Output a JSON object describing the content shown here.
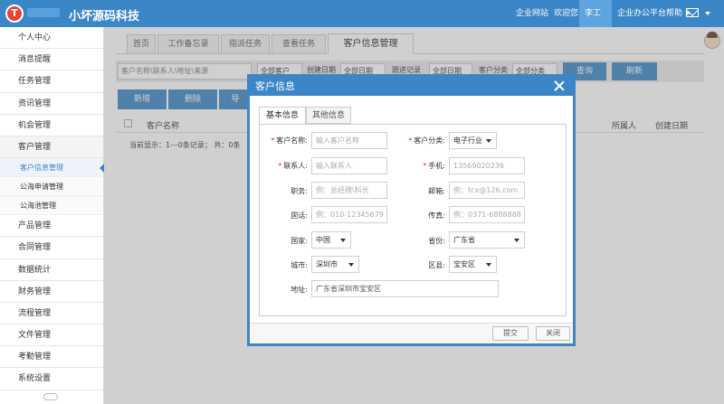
{
  "app": {
    "logo_letter": "T",
    "brand": "小坏源码科技"
  },
  "topnav": {
    "website": "企业网站",
    "welcome": "欢迎您",
    "user": "李工",
    "help": "企业办公平台帮助"
  },
  "sidebar": {
    "items": [
      "个人中心",
      "消息提醒",
      "任务管理",
      "资讯管理",
      "机会管理",
      "客户管理"
    ],
    "subitems": [
      "客户信息管理",
      "公海申请管理",
      "公海池管理"
    ],
    "items_after": [
      "产品管理",
      "合同管理",
      "数据统计",
      "财务管理",
      "流程管理",
      "文件管理",
      "考勤管理",
      "系统设置"
    ]
  },
  "tabs": [
    "首页",
    "工作备忘录",
    "指派任务",
    "查看任务",
    "客户信息管理"
  ],
  "search": {
    "keyword_placeholder": "客户名称\\联系人\\地址\\来源",
    "filter1": "全部客户",
    "filter1_label": "创建日期",
    "filter2": "全部日期",
    "filter2_label": "跟进记录",
    "filter3": "全部日期",
    "filter3_label": "客户分类",
    "filter4": "全部分类",
    "query_button": "查询",
    "refresh_button": "刷新"
  },
  "actions": {
    "add": "新增",
    "delete": "删除",
    "third": "导"
  },
  "grid": {
    "col_name": "客户名称",
    "col_owner": "所属人",
    "col_created": "创建日期",
    "pager": "当前显示：1---0条记录；",
    "pager_total": "共：0条"
  },
  "dialog": {
    "title": "客户信息",
    "tab_basic": "基本信息",
    "tab_other": "其他信息",
    "fields": {
      "name_label": "客户名称:",
      "name_placeholder": "输入客户名称",
      "category_label": "客户分类:",
      "category_value": "电子行业",
      "contact_label": "联系人:",
      "contact_placeholder": "输入联系人",
      "mobile_label": "手机:",
      "mobile_placeholder": "13569020236",
      "position_label": "职务:",
      "position_placeholder": "例：总经理\\科长",
      "email_label": "邮箱:",
      "email_placeholder": "例：tcx@126.com",
      "phone_label": "固话:",
      "phone_placeholder": "例：010-12345679",
      "fax_label": "传真:",
      "fax_placeholder": "例：0371-6888888",
      "country_label": "国家:",
      "country_value": "中国",
      "province_label": "省份:",
      "province_value": "广东省",
      "city_label": "城市:",
      "city_value": "深圳市",
      "district_label": "区县:",
      "district_value": "宝安区",
      "address_label": "地址:",
      "address_value": "广东省深圳市宝安区"
    },
    "submit": "提交",
    "close": "关闭"
  },
  "colors": {
    "primary": "#3b86c6",
    "required": "#d9342b"
  }
}
